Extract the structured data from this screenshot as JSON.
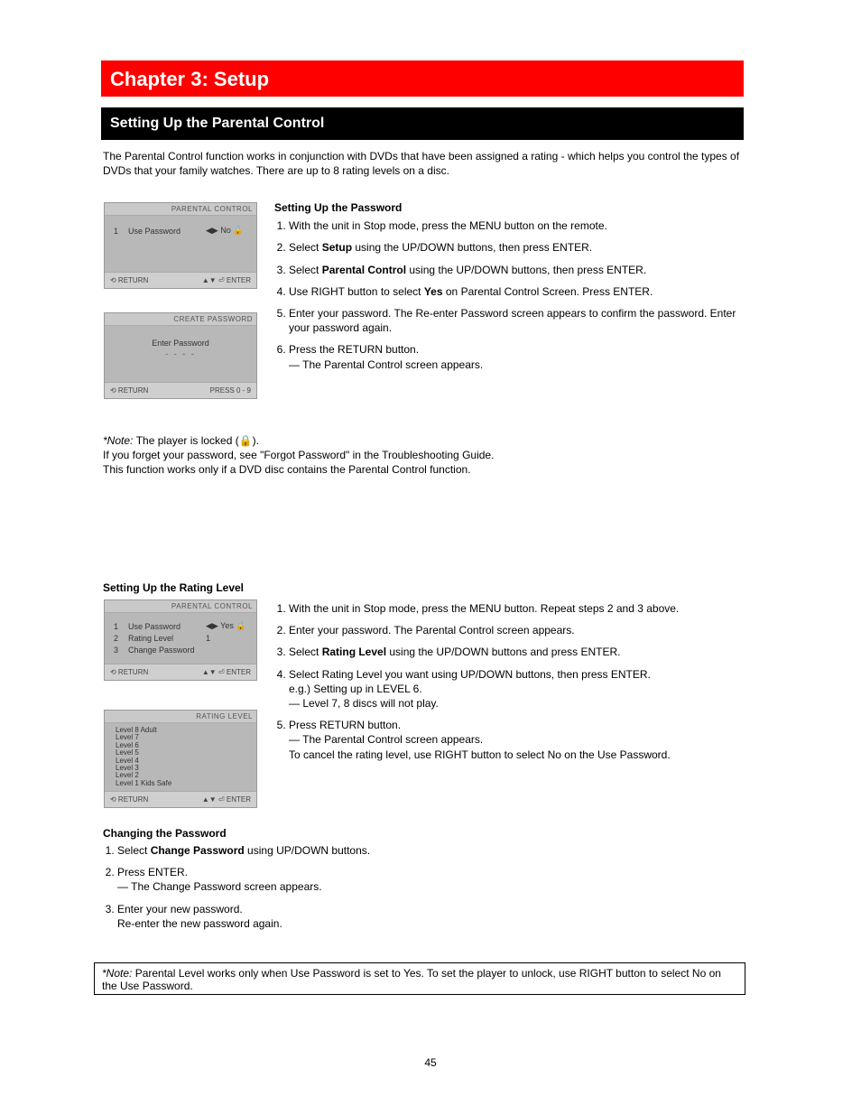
{
  "header": {
    "chapter_title": "Chapter 3: Setup"
  },
  "section": {
    "title": "Setting Up the Parental Control"
  },
  "lead": "The Parental Control function works in conjunction with DVDs that have been assigned a rating - which helps you control the types of DVDs that your family watches. There are up to 8 rating levels on a disc.",
  "osd1": {
    "title": "PARENTAL CONTROL",
    "rows": [
      {
        "num": "1",
        "label": "Use Password",
        "value": "◀▶ No 🔓"
      }
    ],
    "footer_left": "⟲ RETURN",
    "footer_right": "▲▼  ⏎ ENTER"
  },
  "osd2": {
    "title": "CREATE PASSWORD",
    "center_label": "Enter Password",
    "dashes": "- - - -",
    "footer_left": "⟲ RETURN",
    "footer_right": "PRESS 0 - 9"
  },
  "osd3": {
    "title": "PARENTAL CONTROL",
    "rows": [
      {
        "num": "1",
        "label": "Use Password",
        "value": "◀▶ Yes 🔒"
      },
      {
        "num": "2",
        "label": "Rating Level",
        "value": "1"
      },
      {
        "num": "3",
        "label": "Change Password",
        "value": ""
      }
    ],
    "footer_left": "⟲ RETURN",
    "footer_right": "▲▼  ⏎ ENTER"
  },
  "osd4": {
    "title": "RATING LEVEL",
    "levels": [
      "Level 8 Adult",
      "Level 7",
      "Level 6",
      "Level 5",
      "Level 4",
      "Level 3",
      "Level 2",
      "Level 1 Kids Safe"
    ],
    "footer_left": "⟲ RETURN",
    "footer_right": "▲▼  ⏎ ENTER"
  },
  "block_a": {
    "h": "Setting Up the Password",
    "step1": "With the unit in Stop mode, press the MENU button on the remote.",
    "step2_a": "Select ",
    "step2_b": "Setup",
    "step2_c": " using the UP/DOWN buttons, then press ENTER.",
    "step3_a": "Select ",
    "step3_b": "Parental Control",
    "step3_c": " using the UP/DOWN buttons, then press ENTER.",
    "step4_a": "Use RIGHT button to select ",
    "step4_b": "Yes",
    "step4_c": " on Parental Control Screen. Press ENTER.",
    "step5": "Enter your password. The Re-enter Password screen appears to confirm the password. Enter your password again.",
    "step6": "Press the RETURN button.",
    "extra": "— The Parental Control screen appears."
  },
  "note_a": {
    "lead": "*Note: ",
    "l1": "The player is locked (🔒).",
    "l2": "If you forget your password, see \"Forgot Password\" in the Troubleshooting Guide.",
    "l3": "This function works only if a DVD disc contains the Parental Control function."
  },
  "heading_b": "Setting Up the Rating Level",
  "block_b": {
    "step1": "With the unit in Stop mode, press the MENU button. Repeat steps 2 and 3 above.",
    "step2": "Enter your password. The Parental Control screen appears.",
    "step3_a": "Select ",
    "step3_b": "Rating Level",
    "step3_c": " using the UP/DOWN buttons and press ENTER.",
    "step4a": "Select Rating Level you want using UP/DOWN buttons, then press ENTER.",
    "step4b": "e.g.) Setting up in LEVEL 6.",
    "step4b2": " — Level 7, 8 discs will not play.",
    "step5a": "Press RETURN button.",
    "step5b": "— The Parental Control screen appears.",
    "step5c": "To cancel the rating level, use RIGHT button to select No on the Use Password."
  },
  "heading_c": "Changing the Password",
  "block_c": {
    "step1_a": "Select ",
    "step1_b": "Change Password",
    "step1_c": " using UP/DOWN buttons.",
    "step2a": "Press ENTER.",
    "step2b": "— The Change Password screen appears.",
    "step3a": "Enter your new password.",
    "step3b": "Re-enter the new password again."
  },
  "note_box": {
    "lead": "*Note: ",
    "body": "Parental Level works only when Use Password is set to Yes. To set the player to unlock, use RIGHT button to select No on the Use Password."
  },
  "page_number": "45"
}
